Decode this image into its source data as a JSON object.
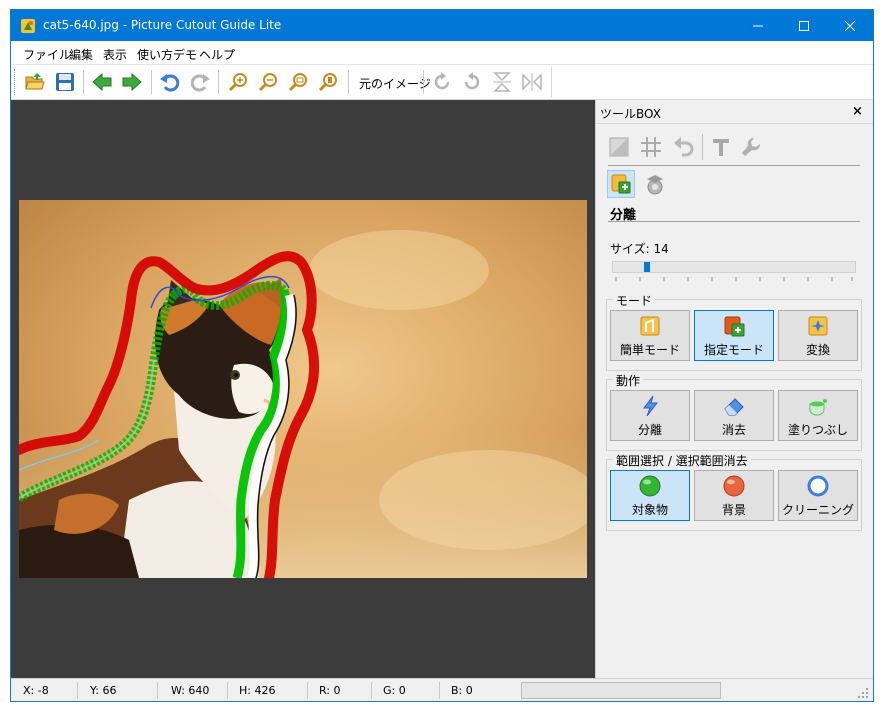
{
  "window": {
    "title": "cat5-640.jpg - Picture Cutout Guide Lite"
  },
  "menu": [
    {
      "label": "ファイル"
    },
    {
      "label": "編集"
    },
    {
      "label": "表示"
    },
    {
      "label": "使い方デモ"
    },
    {
      "label": "ヘルプ"
    }
  ],
  "toolbar": {
    "original_image_label": "元のイメージ",
    "buttons": [
      {
        "name": "open-file",
        "icon": "folder-open-icon"
      },
      {
        "name": "save-file",
        "icon": "floppy-disk-icon"
      },
      {
        "name": "back",
        "icon": "arrow-left-icon"
      },
      {
        "name": "forward",
        "icon": "arrow-right-icon"
      },
      {
        "name": "undo",
        "icon": "undo-icon"
      },
      {
        "name": "redo",
        "icon": "redo-icon"
      },
      {
        "name": "zoom-in",
        "icon": "zoom-in-icon"
      },
      {
        "name": "zoom-out",
        "icon": "zoom-out-icon"
      },
      {
        "name": "zoom-fit",
        "icon": "zoom-fit-icon"
      },
      {
        "name": "zoom-actual",
        "icon": "zoom-actual-icon"
      },
      {
        "name": "rotate-right",
        "icon": "rotate-cw-icon"
      },
      {
        "name": "rotate-left",
        "icon": "rotate-ccw-icon"
      },
      {
        "name": "flip-vertical",
        "icon": "flip-vertical-icon"
      },
      {
        "name": "flip-horizontal",
        "icon": "flip-horizontal-icon"
      }
    ]
  },
  "toolbox": {
    "title": "ツールBOX",
    "close": "×",
    "section_title": "分離",
    "size_label": "サイズ: 14",
    "size_value": 14,
    "mode_group": {
      "label": "モード",
      "buttons": [
        {
          "label": "簡単モード",
          "selected": false
        },
        {
          "label": "指定モード",
          "selected": true
        },
        {
          "label": "変換",
          "selected": false
        }
      ]
    },
    "action_group": {
      "label": "動作",
      "buttons": [
        {
          "label": "分離"
        },
        {
          "label": "消去"
        },
        {
          "label": "塗りつぶし"
        }
      ]
    },
    "range_group": {
      "label": "範囲選択 / 選択範囲消去",
      "buttons": [
        {
          "label": "対象物",
          "selected": true
        },
        {
          "label": "背景",
          "selected": false
        },
        {
          "label": "クリーニング",
          "selected": false
        }
      ]
    }
  },
  "status": {
    "x": "X: -8",
    "y": "Y: 66",
    "w": "W: 640",
    "h": "H: 426",
    "r": "R: 0",
    "g": "G: 0",
    "b": "B: 0"
  },
  "colors": {
    "titlebar": "#0078d7",
    "canvas_bg": "#3c3c3c",
    "selected_button": "#cce4f7",
    "foreground_mark": "#00b400",
    "background_mark": "#d40000"
  }
}
